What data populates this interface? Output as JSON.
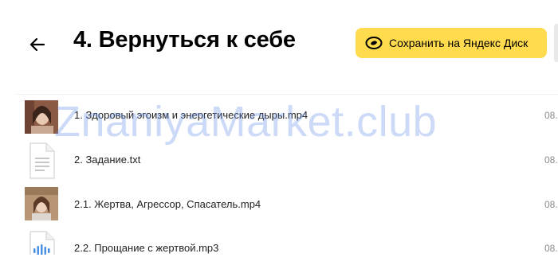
{
  "header": {
    "title": "4. Вернуться к себе",
    "save_button_label": "Сохранить на Яндекс Диск",
    "back_icon": "arrow-left-icon",
    "save_icon": "yandex-disk-icon"
  },
  "files": [
    {
      "name": "1. Здоровый эгоизм и энергетические дыры.mp4",
      "date": "08.",
      "type": "video"
    },
    {
      "name": "2. Задание.txt",
      "date": "08.",
      "type": "text"
    },
    {
      "name": "2.1. Жертва, Агрессор, Спасатель.mp4",
      "date": "08.",
      "type": "video"
    },
    {
      "name": "2.2. Прощание с жертвой.mp3",
      "date": "08.",
      "type": "audio"
    }
  ],
  "watermark": "ZnaniyaMarket.club",
  "colors": {
    "accent_button": "#ffdb4d",
    "text": "#222222",
    "secondary_text": "#8a8a8a",
    "audio_icon": "#4a90e2"
  }
}
